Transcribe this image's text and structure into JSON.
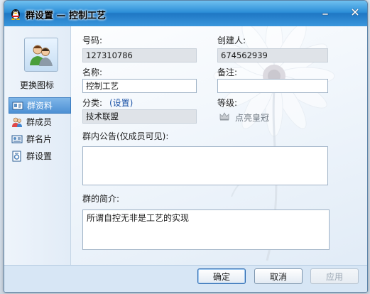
{
  "window": {
    "title": "群设置 — 控制工艺"
  },
  "sidebar": {
    "change_icon_label": "更换图标",
    "items": [
      {
        "label": "群资料",
        "active": true
      },
      {
        "label": "群成员",
        "active": false
      },
      {
        "label": "群名片",
        "active": false
      },
      {
        "label": "群设置",
        "active": false
      }
    ]
  },
  "form": {
    "number_label": "号码:",
    "number_value": "127310786",
    "creator_label": "创建人:",
    "creator_value": "674562939",
    "name_label": "名称:",
    "name_value": "控制工艺",
    "note_label": "备注:",
    "note_value": "",
    "category_label": "分类:",
    "category_link": "(设置)",
    "category_value": "技术联盟",
    "level_label": "等级:",
    "level_value": "点亮皇冠",
    "announcement_label": "群内公告(仅成员可见):",
    "announcement_value": "",
    "intro_label": "群的简介:",
    "intro_value": "所谓自控无非是工艺的实现"
  },
  "footer": {
    "ok_label": "确定",
    "cancel_label": "取消",
    "apply_label": "应用"
  },
  "colors": {
    "titlebar": "#2d8fd8",
    "active_nav": "#4d90d4",
    "link": "#1f56a8"
  }
}
